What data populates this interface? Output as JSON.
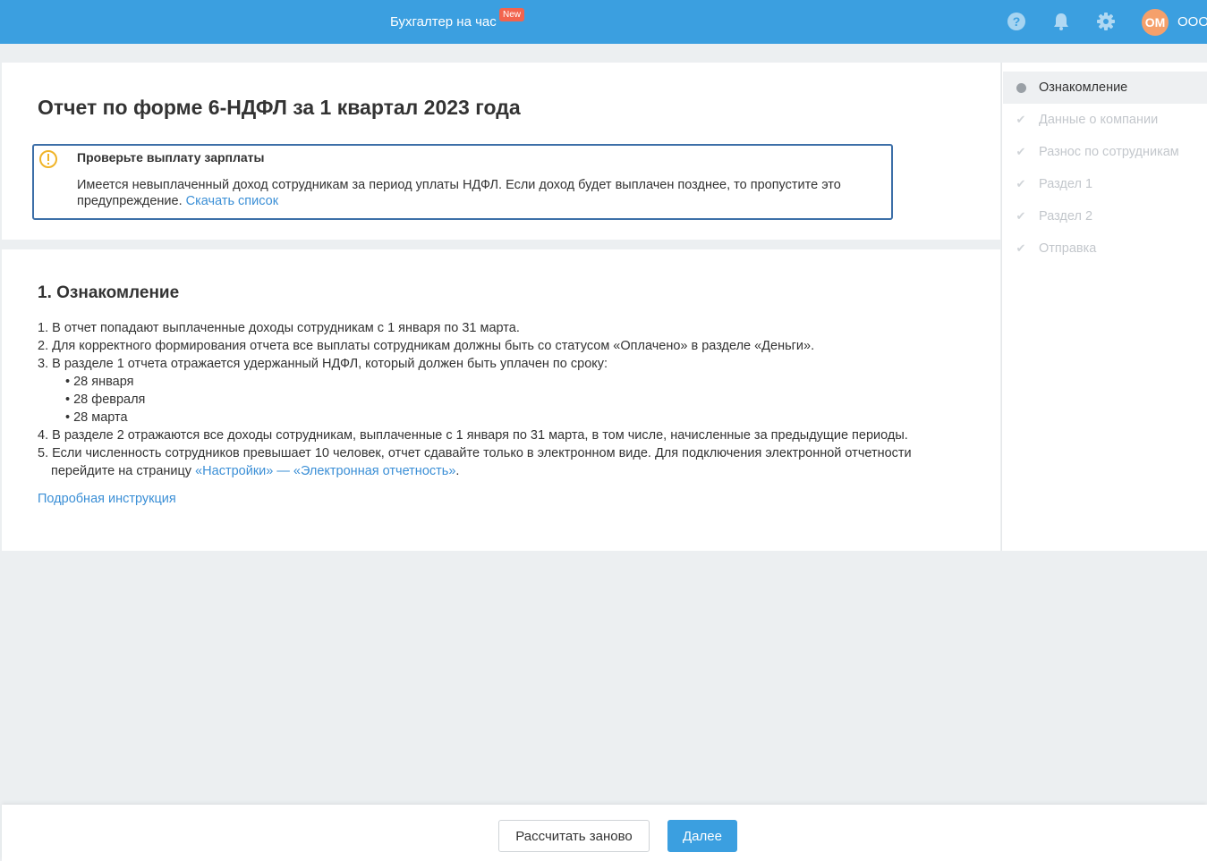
{
  "header": {
    "service_label": "Бухгалтер на час",
    "new_badge": "New",
    "avatar_initials": "ОМ",
    "company_name": "ООО"
  },
  "report": {
    "title": "Отчет по форме 6-НДФЛ за 1 квартал 2023 года",
    "alert": {
      "title": "Проверьте выплату зарплаты",
      "text": "Имеется невыплаченный доход сотрудникам за период уплаты НДФЛ. Если доход будет выплачен позднее, то пропустите это предупреждение.",
      "link": "Скачать список"
    }
  },
  "intro": {
    "title": "1. Ознакомление",
    "items": [
      "1. В отчет попадают выплаченные доходы сотрудникам с 1 января по 31 марта.",
      "2. Для корректного формирования отчета все выплаты сотрудникам должны быть со статусом «Оплачено» в разделе «Деньги».",
      "3. В разделе 1 отчета отражается удержанный НДФЛ, который должен быть уплачен по сроку:",
      "4. В разделе 2 отражаются все доходы сотрудникам, выплаченные с 1 января по 31 марта, в том числе, начисленные за предыдущие периоды.",
      "5. Если численность сотрудников превышает 10 человек, отчет сдавайте только в электронном виде. Для подключения электронной отчетности"
    ],
    "bullets": [
      "• 28 января",
      "• 28 февраля",
      "• 28 марта"
    ],
    "item5_cont": "перейдите на страницу",
    "item5_link": "«Настройки» — «Электронная отчетность»",
    "item5_end": ".",
    "details_link": "Подробная инструкция"
  },
  "steps": [
    {
      "label": "Ознакомление",
      "state": "active"
    },
    {
      "label": "Данные о компании",
      "state": "pending"
    },
    {
      "label": "Разнос по сотрудникам",
      "state": "pending"
    },
    {
      "label": "Раздел 1",
      "state": "pending"
    },
    {
      "label": "Раздел 2",
      "state": "pending"
    },
    {
      "label": "Отправка",
      "state": "pending"
    }
  ],
  "footer": {
    "recalc_label": "Рассчитать заново",
    "next_label": "Далее"
  },
  "colors": {
    "header_bg": "#3b9fe0",
    "link": "#3b8fd6",
    "alert_border": "#3d6fa8",
    "warning": "#f0b429",
    "avatar": "#f5a06b",
    "badge": "#f2644e"
  }
}
